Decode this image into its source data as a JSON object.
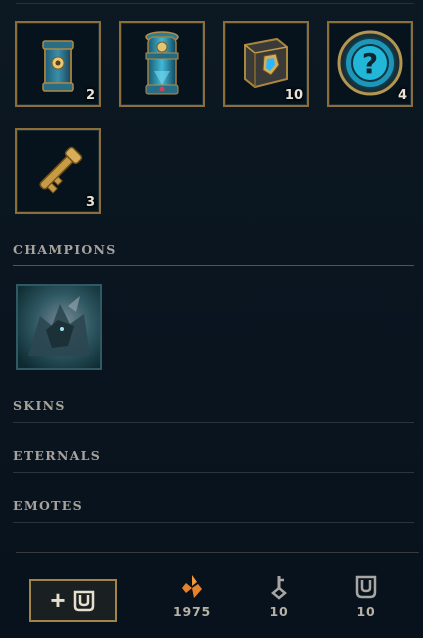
{
  "loot": {
    "items": [
      {
        "name": "Capsule",
        "count": "2"
      },
      {
        "name": "Orb",
        "count": ""
      },
      {
        "name": "Chest",
        "count": "10"
      },
      {
        "name": "Mystery",
        "count": "4"
      },
      {
        "name": "Key",
        "count": "3"
      }
    ]
  },
  "sections": {
    "champions": "CHAMPIONS",
    "skins": "SKINS",
    "eternals": "ETERNALS",
    "emotes": "EMOTES"
  },
  "footer": {
    "add_button_plus": "+",
    "currencies": [
      {
        "name": "orange-essence",
        "value": "1975"
      },
      {
        "name": "key-fragments",
        "value": "10"
      },
      {
        "name": "chests",
        "value": "10"
      }
    ]
  },
  "colors": {
    "tile_border": "#8a6f3a",
    "champion_border": "#2f5a63",
    "section_text": "#a7a29b",
    "orange_essence": "#e8822a"
  }
}
